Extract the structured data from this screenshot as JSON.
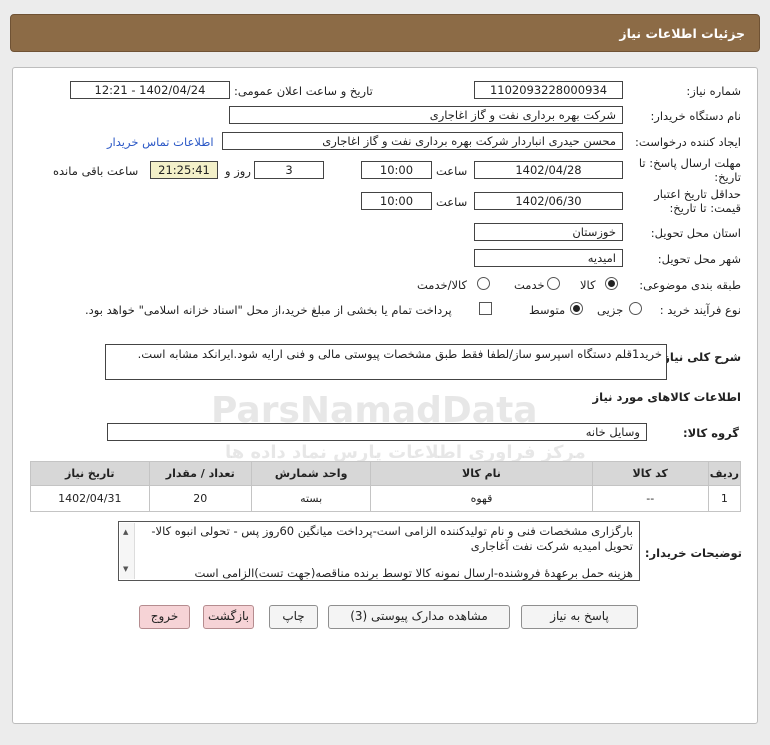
{
  "page": {
    "title": "جزئیات اطلاعات نیاز"
  },
  "fields": {
    "need_number": {
      "label": "شماره نیاز:",
      "value": "1102093228000934"
    },
    "announce": {
      "label": "تاریخ و ساعت اعلان عمومی:",
      "value": "1402/04/24 - 12:21"
    },
    "buyer_org": {
      "label": "نام دستگاه خریدار:",
      "value": "شرکت بهره برداری نفت و گاز اغاجاری"
    },
    "requester": {
      "label": "ایجاد کننده درخواست:",
      "value": "محسن حیدری انباردار شرکت بهره برداری نفت و گاز اغاجاری",
      "contact_link": "اطلاعات تماس خریدار"
    },
    "deadline": {
      "label_line1": "مهلت ارسال پاسخ: تا",
      "label_line2": "تاریخ:",
      "date": "1402/04/28",
      "time_label": "ساعت",
      "time": "10:00",
      "days": "3",
      "days_label": "روز و",
      "remaining": "21:25:41",
      "remaining_label": "ساعت باقی مانده"
    },
    "validity": {
      "label_line1": "حداقل تاریخ اعتبار",
      "label_line2": "قیمت: تا تاریخ:",
      "date": "1402/06/30",
      "time_label": "ساعت",
      "time": "10:00"
    },
    "province": {
      "label": "استان محل تحویل:",
      "value": "خوزستان"
    },
    "city": {
      "label": "شهر محل تحویل:",
      "value": "امیدیه"
    },
    "category": {
      "label": "طبقه بندی موضوعی:",
      "options": [
        "کالا",
        "خدمت",
        "کالا/خدمت"
      ],
      "selected": "کالا"
    },
    "process": {
      "label": "نوع فرآیند خرید :",
      "options": [
        "جزیی",
        "متوسط"
      ],
      "selected": "متوسط",
      "treasury_note": "پرداخت تمام یا بخشی از مبلغ خرید،از محل \"اسناد خزانه اسلامی\" خواهد بود."
    }
  },
  "description": {
    "label": "شرح کلی نیاز:",
    "value": "خرید1قلم دستگاه اسپرسو ساز/لطفا فقط طبق مشخصات پیوستی مالی و فنی ارایه شود.ایرانکد مشابه است."
  },
  "goods_section": {
    "title": "اطلاعات کالاهای مورد نیاز"
  },
  "goods_group": {
    "label": "گروه کالا:",
    "value": "وسایل خانه"
  },
  "table": {
    "headers": [
      "ردیف",
      "کد کالا",
      "نام کالا",
      "واحد شمارش",
      "تعداد / مقدار",
      "تاریخ نیاز"
    ],
    "rows": [
      [
        "1",
        "--",
        "قهوه",
        "بسته",
        "20",
        "1402/04/31"
      ]
    ]
  },
  "buyer_notes": {
    "label": "توضیحات خریدار:",
    "line1": "بارگزاری مشخصات فنی و نام تولیدکننده الزامی است-پرداخت میانگین 60روز پس - تحولی انبوه کالا-",
    "line2": "تحویل امیدیه شرکت نفت آغاجاری",
    "line3": "هزینه حمل برعهدۀ فروشنده-ارسال نمونه کالا توسط برنده مناقصه(جهت تست)الزامی است"
  },
  "buttons": {
    "reply": "پاسخ به نیاز",
    "attachments": "مشاهده مدارک پیوستی (3)",
    "print": "چاپ",
    "back": "بازگشت",
    "exit": "خروج"
  },
  "watermark": {
    "latin": "ParsNamadData",
    "line1": "مرکز فراوری اطلاعات پارس نماد داده ها",
    "line2": "پایگاه اطلاع رسانی مناقصه ومزایده"
  }
}
